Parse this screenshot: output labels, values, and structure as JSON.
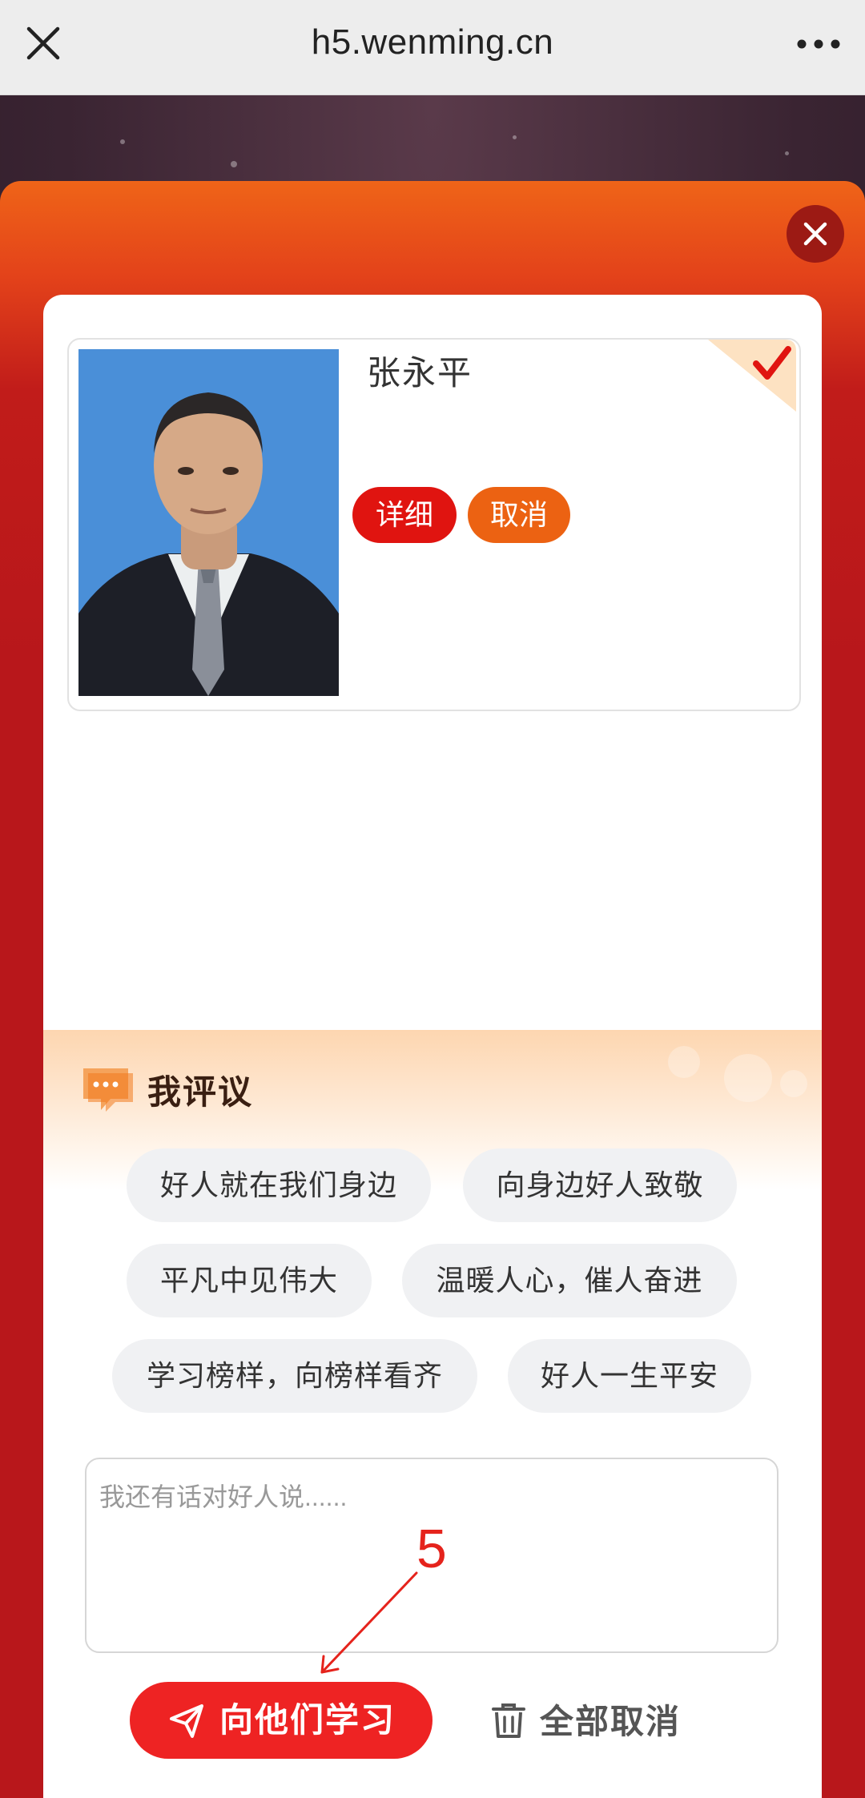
{
  "browser": {
    "url": "h5.wenming.cn"
  },
  "person": {
    "name": "张永平",
    "detail_label": "详细",
    "cancel_label": "取消"
  },
  "comment": {
    "title": "我评议",
    "chips": [
      "好人就在我们身边",
      "向身边好人致敬",
      "平凡中见伟大",
      "温暖人心，催人奋进",
      "学习榜样，向榜样看齐",
      "好人一生平安"
    ],
    "placeholder": "我还有话对好人说......"
  },
  "annotation": {
    "step_number": "5"
  },
  "actions": {
    "learn_label": "向他们学习",
    "cancel_all_label": "全部取消"
  },
  "colors": {
    "header_orange": "#ef6418",
    "modal_red": "#b8171b",
    "detail_red": "#e01410",
    "cancel_orange": "#ec6212",
    "learn_red": "#ee2323",
    "annotation_red": "#e5231c"
  }
}
